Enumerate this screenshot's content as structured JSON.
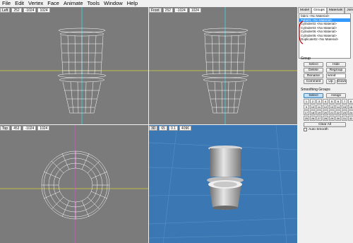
{
  "menu": [
    "File",
    "Edit",
    "Vertex",
    "Face",
    "Animate",
    "Tools",
    "Window",
    "Help"
  ],
  "viewports": {
    "left": {
      "view": "Left",
      "v1": "252",
      "v2": "-1024",
      "v3": "1024"
    },
    "front": {
      "view": "Front",
      "v1": "252",
      "v2": "-1024",
      "v3": "1024"
    },
    "top": {
      "view": "Top",
      "v1": "453",
      "v2": "-1024",
      "v3": "1024"
    },
    "persp": {
      "view": "3D",
      "v1": "65",
      "v2": "0.1",
      "v3": "4096"
    }
  },
  "panel": {
    "tabs": [
      "Model",
      "Groups",
      "Materials",
      "Joints"
    ],
    "active_tab": "Groups",
    "groups": [
      "fabric <No Material>",
      "Tube01 <No Material>",
      "Cylinder02 <No Material>",
      "Cylinder03 <No Material>",
      "Cylinder06 <No Material>",
      "Cylinder05 <No Material>",
      "Duplicate02 <No Material>"
    ],
    "selected_index": 1,
    "group_label": "Group",
    "buttons": {
      "select": "Select",
      "hide": "Hide",
      "delete": "Delete",
      "regroup": "Regroup",
      "rename": "Rename",
      "comment": "Comment",
      "up": "Up",
      "down": "Down"
    },
    "rename_value": "wood",
    "smoothing_label": "Smoothing Groups",
    "sg_select": "Select",
    "sg_assign": "Assign",
    "sg_numbers": [
      "1",
      "2",
      "3",
      "4",
      "5",
      "6",
      "7",
      "8",
      "9",
      "10",
      "11",
      "12",
      "13",
      "14",
      "15",
      "16",
      "17",
      "18",
      "19",
      "20",
      "21",
      "22",
      "23",
      "24",
      "25",
      "26",
      "27",
      "28",
      "29",
      "30",
      "31",
      "32"
    ],
    "clear_all": "Clear All",
    "auto_smooth": "Auto Smooth"
  },
  "colors": {
    "viewport_bg": "#7b7b7b",
    "view3d_bg": "#3b78b3",
    "axis_cyan": "#3cd9e6",
    "axis_yellow": "#d4d43a",
    "axis_magenta": "#d050d0",
    "annotation_red": "#cc0000"
  }
}
